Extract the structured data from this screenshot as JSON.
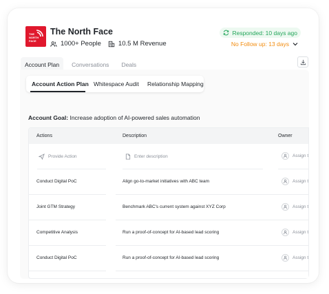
{
  "company": {
    "name": "The North Face",
    "people": "1000+ People",
    "revenue": "10.5 M Revenue",
    "logo_text_line1": "THE",
    "logo_text_line2": "NORTH",
    "logo_text_line3": "FACE"
  },
  "status": {
    "responded": "Responded: 10 days ago",
    "followup": "No Follow up: 13 days"
  },
  "main_tabs": [
    {
      "label": "Account Plan"
    },
    {
      "label": "Conversations"
    },
    {
      "label": "Deals"
    }
  ],
  "sub_tabs": [
    {
      "label": "Account Action Plan"
    },
    {
      "label": "Whitespace Audit"
    },
    {
      "label": "Relationship Mapping"
    }
  ],
  "goal": {
    "label": "Account Goal:",
    "text": "Increase adoption of AI-powered sales automation"
  },
  "table": {
    "headers": {
      "actions": "Actions",
      "description": "Description",
      "owner": "Owner"
    },
    "entry_row": {
      "action_placeholder": "Provide Action",
      "description_placeholder": "Enter description",
      "owner_placeholder": "Assign t"
    },
    "rows": [
      {
        "action": "Conduct Digital PoC",
        "description": "Align go-to-market initiatives with ABC team",
        "owner": "Assign t"
      },
      {
        "action": "Joint GTM Strategy",
        "description": "Benchmark ABC's current system against XYZ Corp",
        "owner": "Assign t"
      },
      {
        "action": "Competitive Analysis",
        "description": "Run a proof-of-concept for AI-based lead scoring",
        "owner": "Assign t"
      },
      {
        "action": "Conduct Digital PoC",
        "description": "Run a proof-of-concept for AI-based lead scoring",
        "owner": "Assign t"
      }
    ]
  },
  "colors": {
    "brand_red": "#e0182d",
    "responded_green": "#23a55a",
    "followup_orange": "#f28c0f"
  },
  "icons": {
    "people": "users-icon",
    "revenue": "building-icon",
    "responded": "refresh-icon",
    "followup": "chevron-down-icon",
    "download": "download-icon",
    "action": "send-icon",
    "description": "document-icon",
    "owner": "user-icon"
  }
}
